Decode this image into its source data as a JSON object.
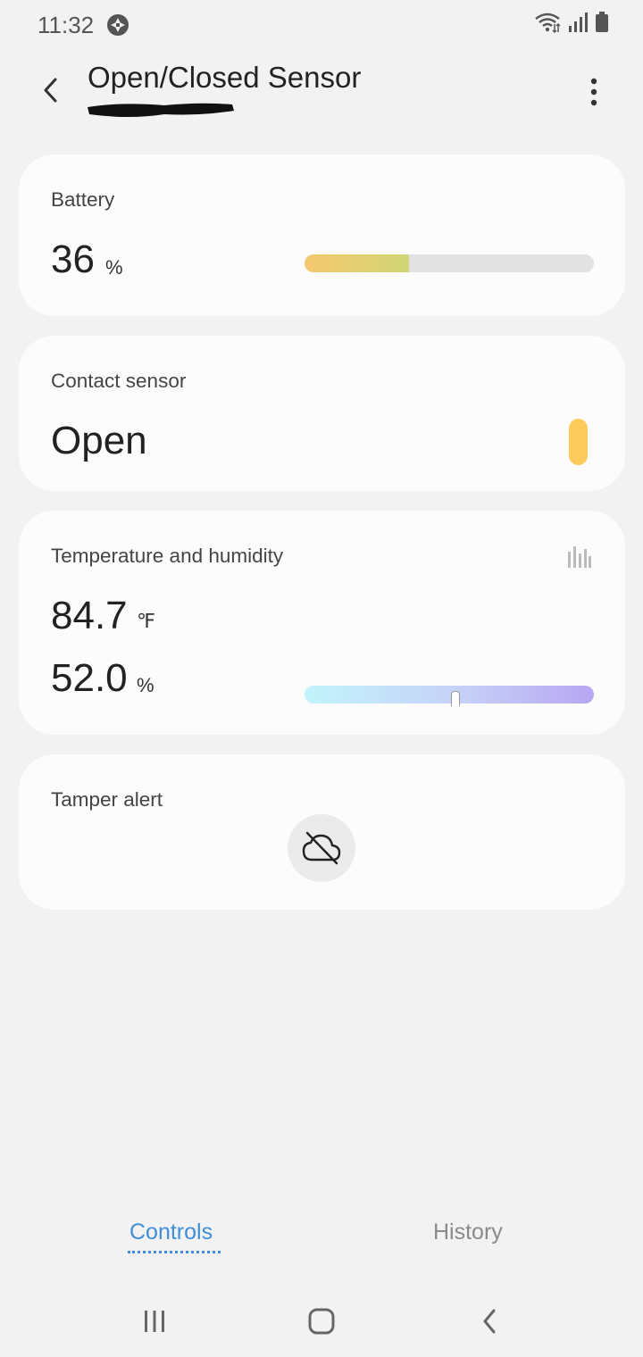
{
  "status_bar": {
    "time": "11:32",
    "icons": [
      "app-notification-icon",
      "wifi-icon",
      "signal-icon",
      "battery-icon"
    ]
  },
  "header": {
    "title": "Open/Closed Sensor",
    "subtitle": "",
    "back_icon": "chevron-left-icon",
    "more_icon": "more-vertical-icon"
  },
  "cards": {
    "battery": {
      "label": "Battery",
      "value": "36",
      "unit": "%",
      "level_percent": 36,
      "fill_colors": [
        "#f5c86e",
        "#d2d676"
      ]
    },
    "contact": {
      "label": "Contact sensor",
      "value": "Open",
      "indicator_color": "#fdca5c"
    },
    "temp_humidity": {
      "label": "Temperature and humidity",
      "temperature": "84.7",
      "temperature_unit": "℉",
      "humidity": "52.0",
      "humidity_unit": "%",
      "humidity_percent": 52,
      "chart_icon": "bar-chart-icon"
    },
    "tamper": {
      "label": "Tamper alert",
      "icon": "cloud-off-icon"
    }
  },
  "tabs": [
    {
      "label": "Controls",
      "active": true,
      "color": "#3e8fd7"
    },
    {
      "label": "History",
      "active": false,
      "color": "#8a8a8a"
    }
  ],
  "nav_bar": {
    "icons": [
      "recent-apps-icon",
      "home-icon",
      "back-icon"
    ]
  }
}
